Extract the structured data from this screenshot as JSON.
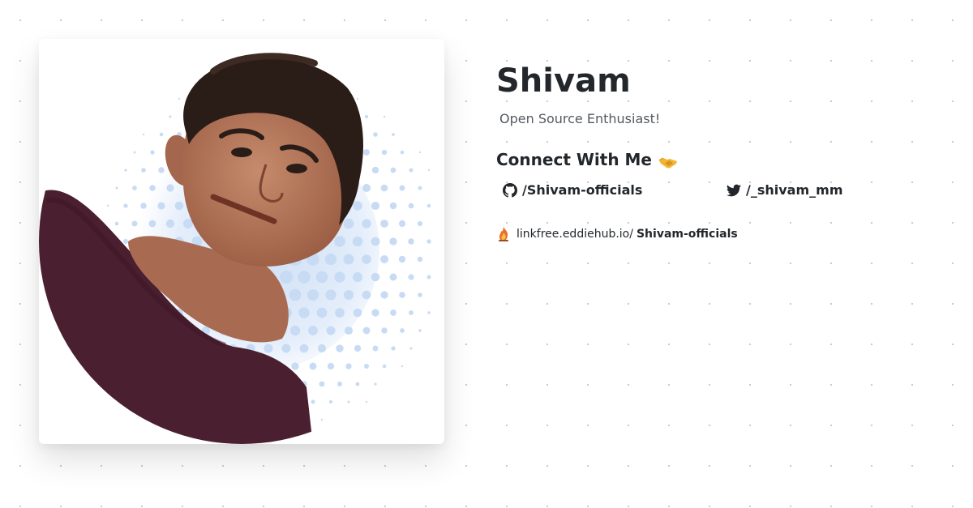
{
  "profile": {
    "name": "Shivam",
    "tagline": "Open Source Enthusiast!",
    "photo_alt": "Shivam profile photo"
  },
  "connect": {
    "heading": "Connect With Me",
    "heading_icon": "handshake-icon",
    "github": {
      "label": "/Shivam-officials",
      "icon": "github-icon"
    },
    "twitter": {
      "label": "/_shivam_mm",
      "icon": "twitter-icon"
    }
  },
  "linkfree": {
    "domain": "linkfree.eddiehub.io/",
    "user": "Shivam-officials",
    "icon": "flame-icon"
  },
  "colors": {
    "text": "#23272b",
    "muted": "#555a60",
    "dots_light": "#c7dbf4",
    "shirt": "#4a1f30",
    "skin": "#b8785e",
    "hair": "#2a1d18"
  }
}
